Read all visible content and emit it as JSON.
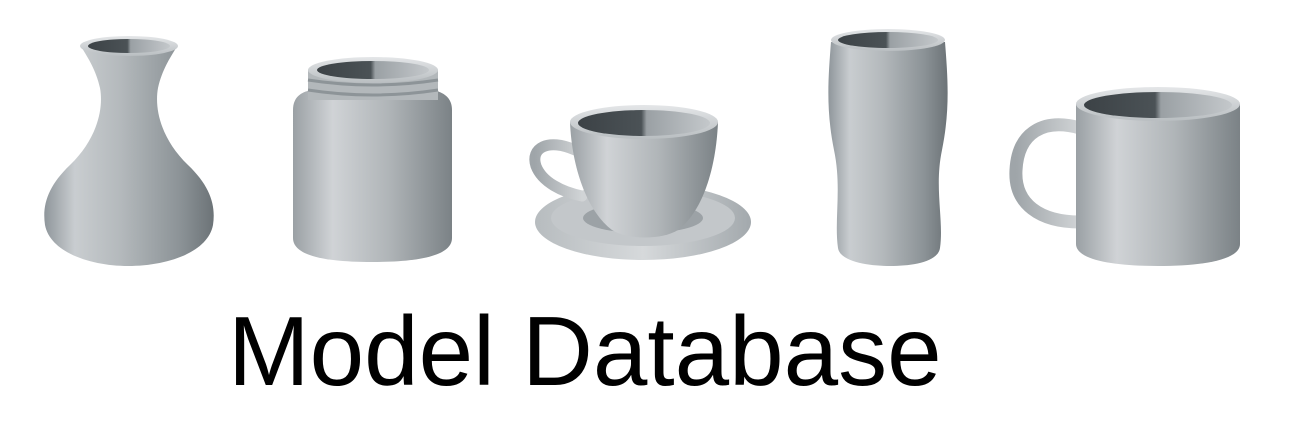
{
  "caption": "Model Database",
  "models": [
    {
      "name": "vase"
    },
    {
      "name": "jar"
    },
    {
      "name": "teacup-with-saucer"
    },
    {
      "name": "tumbler"
    },
    {
      "name": "mug"
    }
  ],
  "colors": {
    "background": "#ffffff",
    "text": "#000000",
    "model_light": "#dde0e2",
    "model_mid": "#a7acb0",
    "model_dark": "#4d5458",
    "model_shadow": "#3e4448"
  }
}
